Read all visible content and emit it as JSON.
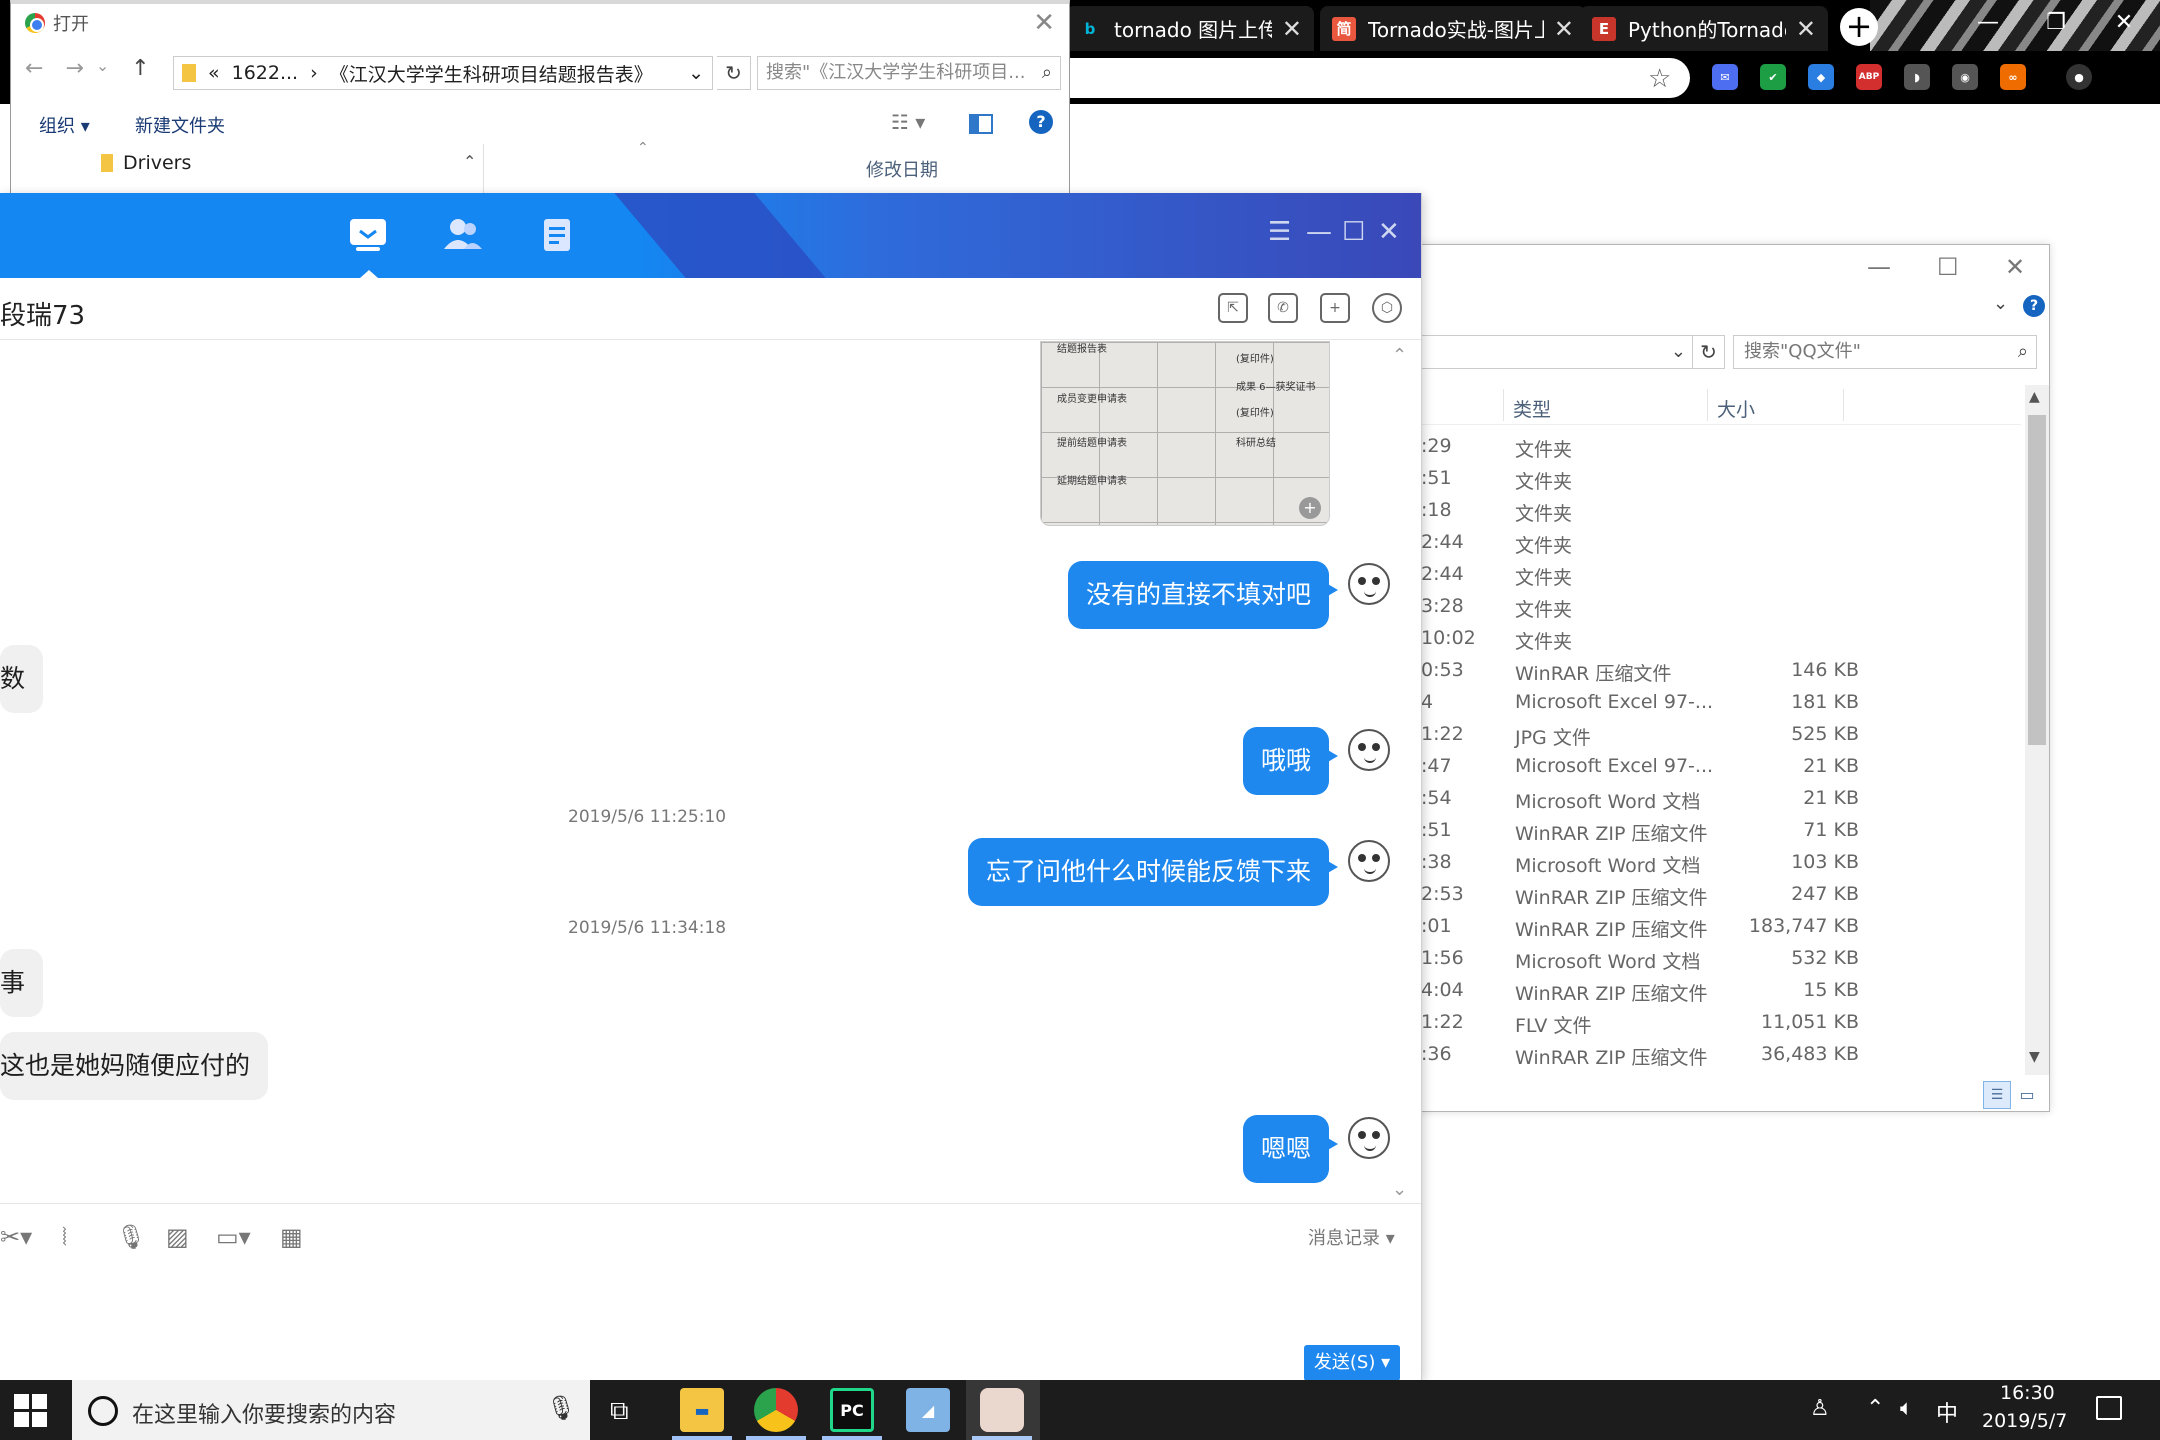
{
  "browser": {
    "tabs": [
      {
        "title": "tornado 图片上传 -",
        "favicon": "bing-icon",
        "fav_text": "b",
        "fav_color": "#00809d"
      },
      {
        "title": "Tornado实战-图片上",
        "favicon": "jianshu-icon",
        "fav_text": "简",
        "fav_color": "#e9573f"
      },
      {
        "title": "Python的Tornado上",
        "favicon": "blog-icon",
        "fav_text": "E",
        "fav_color": "#c7352b"
      }
    ],
    "close_glyph": "✕",
    "new_tab_glyph": "+",
    "window_controls": [
      "—",
      "❐",
      "✕"
    ],
    "extensions": [
      {
        "name": "ext-mail-icon",
        "color": "#4e6ef2",
        "text": "✉"
      },
      {
        "name": "ext-shield-icon",
        "color": "#1e9e44",
        "text": "✔"
      },
      {
        "name": "ext-diamond-icon",
        "color": "#2a7de1",
        "text": "◆"
      },
      {
        "name": "ext-adblock-icon",
        "color": "#d32f2f",
        "text": "ABP"
      },
      {
        "name": "ext-mask-icon",
        "color": "#666666",
        "text": "◗"
      },
      {
        "name": "ext-bulb-icon",
        "color": "#666666",
        "text": "◉"
      },
      {
        "name": "ext-infinity-icon",
        "color": "#ef6c00",
        "text": "∞"
      },
      {
        "name": "ext-account-icon",
        "color": "#444444",
        "text": "●"
      }
    ]
  },
  "open_dialog": {
    "title": "打开",
    "nav": [
      "←",
      "→",
      "⌄"
    ],
    "up": "↑",
    "path_prefix": "«",
    "path_parts": [
      "1622...",
      "›",
      "《江汉大学学生科研项目结题报告表》"
    ],
    "path_dropdown": "⌄",
    "refresh": "↻",
    "search_placeholder": "搜索\"《江汉大学学生科研项目...",
    "organize": "组织 ▾",
    "new_folder": "新建文件夹",
    "view_glyph": "☷ ▾",
    "help": "?",
    "tree_item": "Drivers",
    "col_date": "修改日期",
    "close": "✕"
  },
  "explorer": {
    "window_controls": [
      "—",
      "☐",
      "✕"
    ],
    "expand": "⌄",
    "help": "?",
    "path_dropdown": "⌄",
    "refresh": "↻",
    "search_placeholder": "搜索\"QQ文件\"",
    "col_type": "类型",
    "col_size": "大小",
    "rows": [
      {
        "date": ":29",
        "type": "文件夹",
        "size": ""
      },
      {
        "date": ":51",
        "type": "文件夹",
        "size": ""
      },
      {
        "date": ":18",
        "type": "文件夹",
        "size": ""
      },
      {
        "date": "2:44",
        "type": "文件夹",
        "size": ""
      },
      {
        "date": "2:44",
        "type": "文件夹",
        "size": ""
      },
      {
        "date": "3:28",
        "type": "文件夹",
        "size": ""
      },
      {
        "date": "10:02",
        "type": "文件夹",
        "size": ""
      },
      {
        "date": "0:53",
        "type": "WinRAR 压缩文件",
        "size": "146 KB"
      },
      {
        "date": "4",
        "type": "Microsoft Excel 97-...",
        "size": "181 KB"
      },
      {
        "date": "1:22",
        "type": "JPG 文件",
        "size": "525 KB"
      },
      {
        "date": ":47",
        "type": "Microsoft Excel 97-...",
        "size": "21 KB"
      },
      {
        "date": ":54",
        "type": "Microsoft Word 文档",
        "size": "21 KB"
      },
      {
        "date": ":51",
        "type": "WinRAR ZIP 压缩文件",
        "size": "71 KB"
      },
      {
        "date": ":38",
        "type": "Microsoft Word 文档",
        "size": "103 KB"
      },
      {
        "date": "2:53",
        "type": "WinRAR ZIP 压缩文件",
        "size": "247 KB"
      },
      {
        "date": ":01",
        "type": "WinRAR ZIP 压缩文件",
        "size": "183,747 KB"
      },
      {
        "date": "1:56",
        "type": "Microsoft Word 文档",
        "size": "532 KB"
      },
      {
        "date": "4:04",
        "type": "WinRAR ZIP 压缩文件",
        "size": "15 KB"
      },
      {
        "date": "1:22",
        "type": "FLV 文件",
        "size": "11,051 KB"
      },
      {
        "date": ":36",
        "type": "WinRAR ZIP 压缩文件",
        "size": "36,483 KB"
      }
    ]
  },
  "qq": {
    "contact_name": "段瑞73",
    "window_controls": [
      "☰",
      "—",
      "☐",
      "✕"
    ],
    "doc_thumb_text": [
      "结题报告表",
      "(复印件)",
      "成员变更申请表",
      "成果 6—获奖证书",
      "(复印件)",
      "提前结题申请表",
      "科研总结",
      "延期结题申请表"
    ],
    "messages": [
      {
        "dir": "out",
        "text": "没有的直接不填对吧"
      },
      {
        "dir": "in",
        "text": "数"
      },
      {
        "dir": "out",
        "text": "哦哦"
      },
      {
        "dir": "out",
        "text": "忘了问他什么时候能反馈下来"
      },
      {
        "dir": "in",
        "text": "事"
      },
      {
        "dir": "in",
        "text": "这也是她妈随便应付的"
      },
      {
        "dir": "out",
        "text": "嗯嗯"
      }
    ],
    "timestamps": [
      "2019/5/6 11:25:10",
      "2019/5/6 11:34:18"
    ],
    "history_label": "消息记录 ▾",
    "send_label": "发送(S) ▾",
    "collapse": "⌄",
    "close_small": "⌃"
  },
  "taskbar": {
    "search_placeholder": "在这里输入你要搜索的内容",
    "time": "16:30",
    "date": "2019/5/7",
    "ime": "中"
  }
}
